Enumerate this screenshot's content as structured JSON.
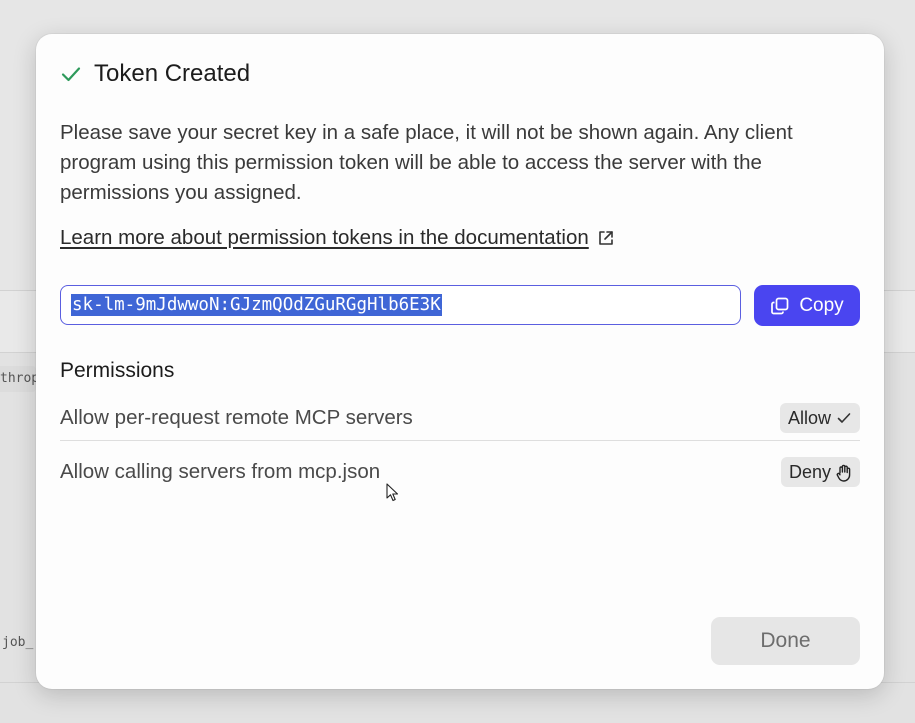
{
  "background": {
    "fragment_left_1": "throp",
    "fragment_left_2": "job_"
  },
  "dialog": {
    "title": "Token Created",
    "title_icon": "check-icon",
    "description": "Please save your secret key in a safe place, it will not be shown again. Any client program using this permission token will be able to access the server with the permissions you assigned.",
    "doc_link_text": "Learn more about permission tokens in the documentation",
    "doc_link_icon": "external-link-icon",
    "token_value": "sk-lm-9mJdwwoN:GJzmQOdZGuRGgHlb6E3K",
    "copy_label": "Copy",
    "copy_icon": "copy-icon",
    "permissions_heading": "Permissions",
    "permissions": [
      {
        "label": "Allow per-request remote MCP servers",
        "value": "Allow",
        "icon": "check-icon"
      },
      {
        "label": "Allow calling servers from mcp.json",
        "value": "Deny",
        "icon": "hand-icon"
      }
    ],
    "done_label": "Done"
  },
  "colors": {
    "accent": "#4a45f0",
    "success_check": "#2e9a5b",
    "selection": "#3f66d6"
  }
}
